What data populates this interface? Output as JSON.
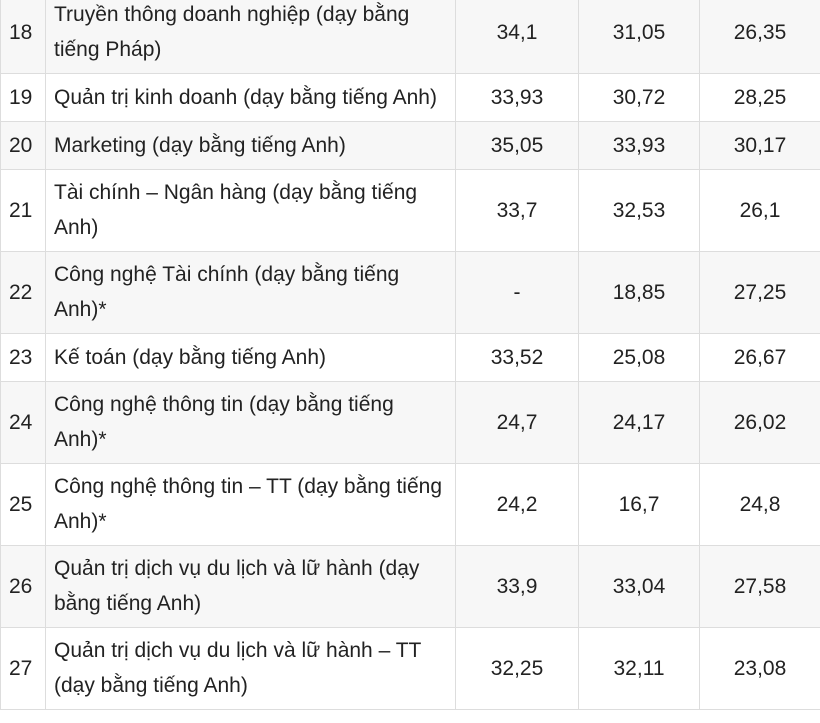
{
  "rows": [
    {
      "stt": "18",
      "name": "Truyền thông doanh nghiệp (dạy bằng tiếng Pháp)",
      "v1": "34,1",
      "v2": "31,05",
      "v3": "26,35"
    },
    {
      "stt": "19",
      "name": "Quản trị kinh doanh (dạy bằng tiếng Anh)",
      "v1": "33,93",
      "v2": "30,72",
      "v3": "28,25"
    },
    {
      "stt": "20",
      "name": "Marketing (dạy bằng tiếng Anh)",
      "v1": "35,05",
      "v2": "33,93",
      "v3": "30,17"
    },
    {
      "stt": "21",
      "name": "Tài chính – Ngân hàng (dạy bằng tiếng Anh)",
      "v1": "33,7",
      "v2": "32,53",
      "v3": "26,1"
    },
    {
      "stt": "22",
      "name": "Công nghệ Tài chính (dạy bằng tiếng Anh)*",
      "v1": "-",
      "v2": "18,85",
      "v3": "27,25"
    },
    {
      "stt": "23",
      "name": "Kế toán (dạy bằng tiếng Anh)",
      "v1": "33,52",
      "v2": "25,08",
      "v3": "26,67"
    },
    {
      "stt": "24",
      "name": "Công nghệ thông tin (dạy bằng tiếng Anh)*",
      "v1": "24,7",
      "v2": "24,17",
      "v3": "26,02"
    },
    {
      "stt": "25",
      "name": "Công nghệ thông tin – TT (dạy bằng tiếng Anh)*",
      "v1": "24,2",
      "v2": "16,7",
      "v3": "24,8"
    },
    {
      "stt": "26",
      "name": "Quản trị dịch vụ du lịch và lữ hành (dạy bằng tiếng Anh)",
      "v1": "33,9",
      "v2": "33,04",
      "v3": "27,58"
    },
    {
      "stt": "27",
      "name": "Quản trị dịch vụ du lịch và lữ hành – TT (dạy bằng tiếng Anh)",
      "v1": "32,25",
      "v2": "32,11",
      "v3": "23,08"
    }
  ]
}
